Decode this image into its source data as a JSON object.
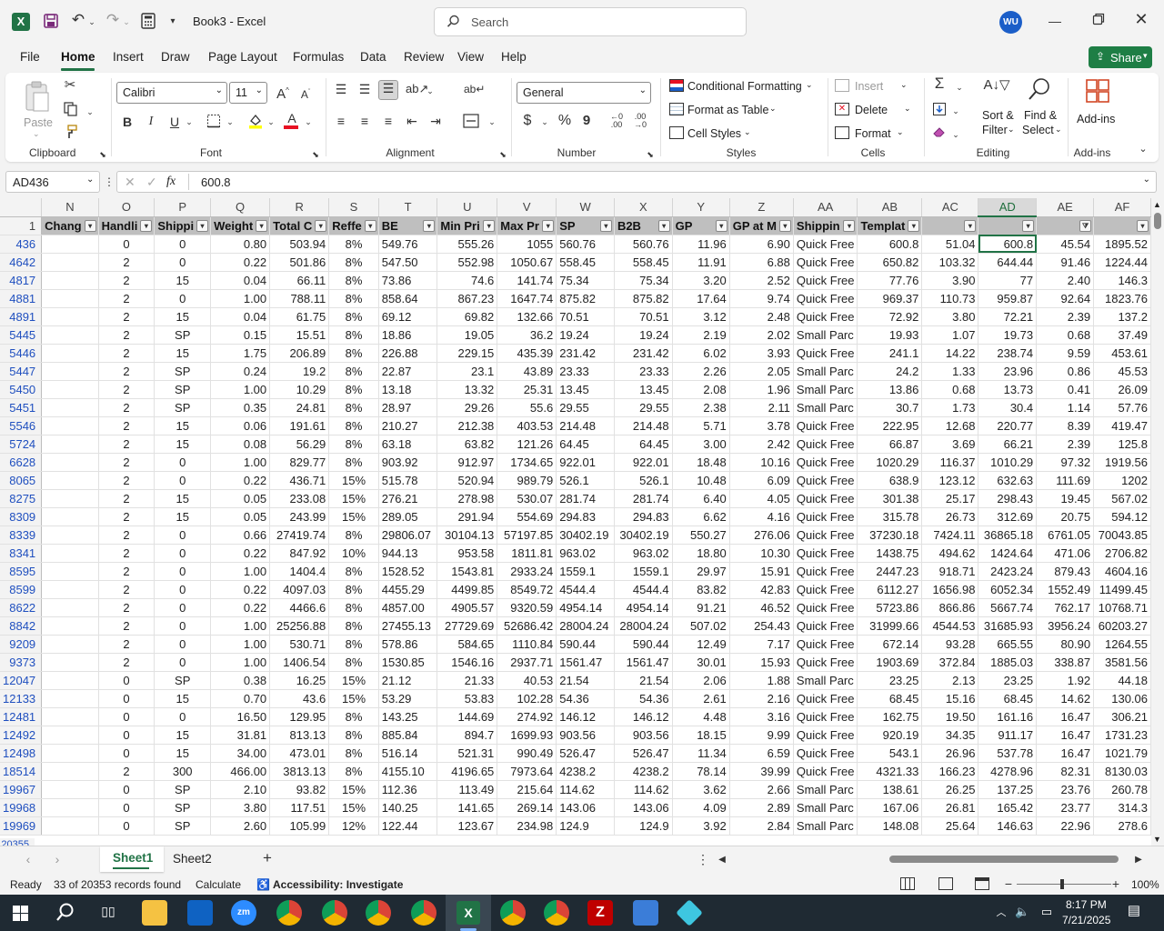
{
  "titlebar": {
    "doc_title": "Book3  -  Excel",
    "search_placeholder": "Search",
    "avatar_initials": "WU"
  },
  "tabs": [
    "File",
    "Home",
    "Insert",
    "Draw",
    "Page Layout",
    "Formulas",
    "Data",
    "Review",
    "View",
    "Help"
  ],
  "active_tab": "Home",
  "share_label": "Share",
  "ribbon": {
    "clipboard": {
      "paste": "Paste",
      "label": "Clipboard"
    },
    "font": {
      "name": "Calibri",
      "size": "11",
      "label": "Font",
      "bold": "B",
      "italic": "I",
      "underline": "U"
    },
    "alignment": {
      "label": "Alignment"
    },
    "number": {
      "format": "General",
      "label": "Number",
      "currency": "$",
      "percent": "%",
      "comma": "9"
    },
    "styles": {
      "conditional": "Conditional Formatting",
      "table": "Format as Table",
      "cell": "Cell Styles",
      "label": "Styles"
    },
    "cells": {
      "insert": "Insert",
      "delete": "Delete",
      "format": "Format",
      "label": "Cells"
    },
    "editing": {
      "sort1": "Sort &",
      "sort2": "Filter",
      "find1": "Find &",
      "find2": "Select",
      "label": "Editing"
    },
    "addins": {
      "text": "Add-ins",
      "label": "Add-ins"
    }
  },
  "formula_bar": {
    "name_box": "AD436",
    "fx": "fx",
    "value": "600.8"
  },
  "columns": [
    "N",
    "O",
    "P",
    "Q",
    "R",
    "S",
    "T",
    "U",
    "V",
    "W",
    "X",
    "Y",
    "Z",
    "AA",
    "AB",
    "AC",
    "AD",
    "AE",
    "AF"
  ],
  "selected_column": "AD",
  "header_row_number": "1",
  "headers": [
    "Chang",
    "Handli",
    "Shippi",
    "Weight",
    "Total C",
    "Reffe",
    "BE",
    "Min Pri",
    "Max Pr",
    "SP",
    "B2B",
    "GP",
    "GP at M",
    "Shippin",
    "Templat",
    "",
    "",
    "",
    ""
  ],
  "rows": [
    {
      "n": "436",
      "c": [
        "",
        "0",
        "0",
        "0.80",
        "503.94",
        "8%",
        "549.76",
        "555.26",
        "1055",
        "560.76",
        "560.76",
        "11.96",
        "6.90",
        "Quick Free",
        "600.8",
        "51.04",
        "600.8",
        "45.54",
        "1895.52"
      ]
    },
    {
      "n": "4642",
      "c": [
        "",
        "2",
        "0",
        "0.22",
        "501.86",
        "8%",
        "547.50",
        "552.98",
        "1050.67",
        "558.45",
        "558.45",
        "11.91",
        "6.88",
        "Quick Free",
        "650.82",
        "103.32",
        "644.44",
        "91.46",
        "1224.44"
      ]
    },
    {
      "n": "4817",
      "c": [
        "",
        "2",
        "15",
        "0.04",
        "66.11",
        "8%",
        "73.86",
        "74.6",
        "141.74",
        "75.34",
        "75.34",
        "3.20",
        "2.52",
        "Quick Free",
        "77.76",
        "3.90",
        "77",
        "2.40",
        "146.3"
      ]
    },
    {
      "n": "4881",
      "c": [
        "",
        "2",
        "0",
        "1.00",
        "788.11",
        "8%",
        "858.64",
        "867.23",
        "1647.74",
        "875.82",
        "875.82",
        "17.64",
        "9.74",
        "Quick Free",
        "969.37",
        "110.73",
        "959.87",
        "92.64",
        "1823.76"
      ]
    },
    {
      "n": "4891",
      "c": [
        "",
        "2",
        "15",
        "0.04",
        "61.75",
        "8%",
        "69.12",
        "69.82",
        "132.66",
        "70.51",
        "70.51",
        "3.12",
        "2.48",
        "Quick Free",
        "72.92",
        "3.80",
        "72.21",
        "2.39",
        "137.2"
      ]
    },
    {
      "n": "5445",
      "c": [
        "",
        "2",
        "SP",
        "0.15",
        "15.51",
        "8%",
        "18.86",
        "19.05",
        "36.2",
        "19.24",
        "19.24",
        "2.19",
        "2.02",
        "Small Parc",
        "19.93",
        "1.07",
        "19.73",
        "0.68",
        "37.49"
      ]
    },
    {
      "n": "5446",
      "c": [
        "",
        "2",
        "15",
        "1.75",
        "206.89",
        "8%",
        "226.88",
        "229.15",
        "435.39",
        "231.42",
        "231.42",
        "6.02",
        "3.93",
        "Quick Free",
        "241.1",
        "14.22",
        "238.74",
        "9.59",
        "453.61"
      ]
    },
    {
      "n": "5447",
      "c": [
        "",
        "2",
        "SP",
        "0.24",
        "19.2",
        "8%",
        "22.87",
        "23.1",
        "43.89",
        "23.33",
        "23.33",
        "2.26",
        "2.05",
        "Small Parc",
        "24.2",
        "1.33",
        "23.96",
        "0.86",
        "45.53"
      ]
    },
    {
      "n": "5450",
      "c": [
        "",
        "2",
        "SP",
        "1.00",
        "10.29",
        "8%",
        "13.18",
        "13.32",
        "25.31",
        "13.45",
        "13.45",
        "2.08",
        "1.96",
        "Small Parc",
        "13.86",
        "0.68",
        "13.73",
        "0.41",
        "26.09"
      ]
    },
    {
      "n": "5451",
      "c": [
        "",
        "2",
        "SP",
        "0.35",
        "24.81",
        "8%",
        "28.97",
        "29.26",
        "55.6",
        "29.55",
        "29.55",
        "2.38",
        "2.11",
        "Small Parc",
        "30.7",
        "1.73",
        "30.4",
        "1.14",
        "57.76"
      ]
    },
    {
      "n": "5546",
      "c": [
        "",
        "2",
        "15",
        "0.06",
        "191.61",
        "8%",
        "210.27",
        "212.38",
        "403.53",
        "214.48",
        "214.48",
        "5.71",
        "3.78",
        "Quick Free",
        "222.95",
        "12.68",
        "220.77",
        "8.39",
        "419.47"
      ]
    },
    {
      "n": "5724",
      "c": [
        "",
        "2",
        "15",
        "0.08",
        "56.29",
        "8%",
        "63.18",
        "63.82",
        "121.26",
        "64.45",
        "64.45",
        "3.00",
        "2.42",
        "Quick Free",
        "66.87",
        "3.69",
        "66.21",
        "2.39",
        "125.8"
      ]
    },
    {
      "n": "6628",
      "c": [
        "",
        "2",
        "0",
        "1.00",
        "829.77",
        "8%",
        "903.92",
        "912.97",
        "1734.65",
        "922.01",
        "922.01",
        "18.48",
        "10.16",
        "Quick Free",
        "1020.29",
        "116.37",
        "1010.29",
        "97.32",
        "1919.56"
      ]
    },
    {
      "n": "8065",
      "c": [
        "",
        "2",
        "0",
        "0.22",
        "436.71",
        "15%",
        "515.78",
        "520.94",
        "989.79",
        "526.1",
        "526.1",
        "10.48",
        "6.09",
        "Quick Free",
        "638.9",
        "123.12",
        "632.63",
        "111.69",
        "1202"
      ]
    },
    {
      "n": "8275",
      "c": [
        "",
        "2",
        "15",
        "0.05",
        "233.08",
        "15%",
        "276.21",
        "278.98",
        "530.07",
        "281.74",
        "281.74",
        "6.40",
        "4.05",
        "Quick Free",
        "301.38",
        "25.17",
        "298.43",
        "19.45",
        "567.02"
      ]
    },
    {
      "n": "8309",
      "c": [
        "",
        "2",
        "15",
        "0.05",
        "243.99",
        "15%",
        "289.05",
        "291.94",
        "554.69",
        "294.83",
        "294.83",
        "6.62",
        "4.16",
        "Quick Free",
        "315.78",
        "26.73",
        "312.69",
        "20.75",
        "594.12"
      ]
    },
    {
      "n": "8339",
      "c": [
        "",
        "2",
        "0",
        "0.66",
        "27419.74",
        "8%",
        "29806.07",
        "30104.13",
        "57197.85",
        "30402.19",
        "30402.19",
        "550.27",
        "276.06",
        "Quick Free",
        "37230.18",
        "7424.11",
        "36865.18",
        "6761.05",
        "70043.85"
      ]
    },
    {
      "n": "8341",
      "c": [
        "",
        "2",
        "0",
        "0.22",
        "847.92",
        "10%",
        "944.13",
        "953.58",
        "1811.81",
        "963.02",
        "963.02",
        "18.80",
        "10.30",
        "Quick Free",
        "1438.75",
        "494.62",
        "1424.64",
        "471.06",
        "2706.82"
      ]
    },
    {
      "n": "8595",
      "c": [
        "",
        "2",
        "0",
        "1.00",
        "1404.4",
        "8%",
        "1528.52",
        "1543.81",
        "2933.24",
        "1559.1",
        "1559.1",
        "29.97",
        "15.91",
        "Quick Free",
        "2447.23",
        "918.71",
        "2423.24",
        "879.43",
        "4604.16"
      ]
    },
    {
      "n": "8599",
      "c": [
        "",
        "2",
        "0",
        "0.22",
        "4097.03",
        "8%",
        "4455.29",
        "4499.85",
        "8549.72",
        "4544.4",
        "4544.4",
        "83.82",
        "42.83",
        "Quick Free",
        "6112.27",
        "1656.98",
        "6052.34",
        "1552.49",
        "11499.45"
      ]
    },
    {
      "n": "8622",
      "c": [
        "",
        "2",
        "0",
        "0.22",
        "4466.6",
        "8%",
        "4857.00",
        "4905.57",
        "9320.59",
        "4954.14",
        "4954.14",
        "91.21",
        "46.52",
        "Quick Free",
        "5723.86",
        "866.86",
        "5667.74",
        "762.17",
        "10768.71"
      ]
    },
    {
      "n": "8842",
      "c": [
        "",
        "2",
        "0",
        "1.00",
        "25256.88",
        "8%",
        "27455.13",
        "27729.69",
        "52686.42",
        "28004.24",
        "28004.24",
        "507.02",
        "254.43",
        "Quick Free",
        "31999.66",
        "4544.53",
        "31685.93",
        "3956.24",
        "60203.27"
      ]
    },
    {
      "n": "9209",
      "c": [
        "",
        "2",
        "0",
        "1.00",
        "530.71",
        "8%",
        "578.86",
        "584.65",
        "1110.84",
        "590.44",
        "590.44",
        "12.49",
        "7.17",
        "Quick Free",
        "672.14",
        "93.28",
        "665.55",
        "80.90",
        "1264.55"
      ]
    },
    {
      "n": "9373",
      "c": [
        "",
        "2",
        "0",
        "1.00",
        "1406.54",
        "8%",
        "1530.85",
        "1546.16",
        "2937.71",
        "1561.47",
        "1561.47",
        "30.01",
        "15.93",
        "Quick Free",
        "1903.69",
        "372.84",
        "1885.03",
        "338.87",
        "3581.56"
      ]
    },
    {
      "n": "12047",
      "c": [
        "",
        "0",
        "SP",
        "0.38",
        "16.25",
        "15%",
        "21.12",
        "21.33",
        "40.53",
        "21.54",
        "21.54",
        "2.06",
        "1.88",
        "Small Parc",
        "23.25",
        "2.13",
        "23.25",
        "1.92",
        "44.18"
      ]
    },
    {
      "n": "12133",
      "c": [
        "",
        "0",
        "15",
        "0.70",
        "43.6",
        "15%",
        "53.29",
        "53.83",
        "102.28",
        "54.36",
        "54.36",
        "2.61",
        "2.16",
        "Quick Free",
        "68.45",
        "15.16",
        "68.45",
        "14.62",
        "130.06"
      ]
    },
    {
      "n": "12481",
      "c": [
        "",
        "0",
        "0",
        "16.50",
        "129.95",
        "8%",
        "143.25",
        "144.69",
        "274.92",
        "146.12",
        "146.12",
        "4.48",
        "3.16",
        "Quick Free",
        "162.75",
        "19.50",
        "161.16",
        "16.47",
        "306.21"
      ]
    },
    {
      "n": "12492",
      "c": [
        "",
        "0",
        "15",
        "31.81",
        "813.13",
        "8%",
        "885.84",
        "894.7",
        "1699.93",
        "903.56",
        "903.56",
        "18.15",
        "9.99",
        "Quick Free",
        "920.19",
        "34.35",
        "911.17",
        "16.47",
        "1731.23"
      ]
    },
    {
      "n": "12498",
      "c": [
        "",
        "0",
        "15",
        "34.00",
        "473.01",
        "8%",
        "516.14",
        "521.31",
        "990.49",
        "526.47",
        "526.47",
        "11.34",
        "6.59",
        "Quick Free",
        "543.1",
        "26.96",
        "537.78",
        "16.47",
        "1021.79"
      ]
    },
    {
      "n": "18514",
      "c": [
        "",
        "2",
        "300",
        "466.00",
        "3813.13",
        "8%",
        "4155.10",
        "4196.65",
        "7973.64",
        "4238.2",
        "4238.2",
        "78.14",
        "39.99",
        "Quick Free",
        "4321.33",
        "166.23",
        "4278.96",
        "82.31",
        "8130.03"
      ]
    },
    {
      "n": "19967",
      "c": [
        "",
        "0",
        "SP",
        "2.10",
        "93.82",
        "15%",
        "112.36",
        "113.49",
        "215.64",
        "114.62",
        "114.62",
        "3.62",
        "2.66",
        "Small Parc",
        "138.61",
        "26.25",
        "137.25",
        "23.76",
        "260.78"
      ]
    },
    {
      "n": "19968",
      "c": [
        "",
        "0",
        "SP",
        "3.80",
        "117.51",
        "15%",
        "140.25",
        "141.65",
        "269.14",
        "143.06",
        "143.06",
        "4.09",
        "2.89",
        "Small Parc",
        "167.06",
        "26.81",
        "165.42",
        "23.77",
        "314.3"
      ]
    },
    {
      "n": "19969",
      "c": [
        "",
        "0",
        "SP",
        "2.60",
        "105.99",
        "12%",
        "122.44",
        "123.67",
        "234.98",
        "124.9",
        "124.9",
        "3.92",
        "2.84",
        "Small Parc",
        "148.08",
        "25.64",
        "146.63",
        "22.96",
        "278.6"
      ]
    }
  ],
  "partial_row_number": "20355",
  "sheets": [
    "Sheet1",
    "Sheet2"
  ],
  "active_sheet": "Sheet1",
  "status": {
    "ready": "Ready",
    "records": "33 of 20353 records found",
    "calculate": "Calculate",
    "accessibility": "Accessibility: Investigate",
    "zoom": "100%"
  },
  "taskbar": {
    "time": "8:17 PM",
    "date": "7/21/2025"
  },
  "colors": {
    "excel_green": "#217346",
    "header_fill": "#bfbfbf",
    "row_number_blue": "#1f4fbf",
    "share_green": "#1e7e45"
  }
}
